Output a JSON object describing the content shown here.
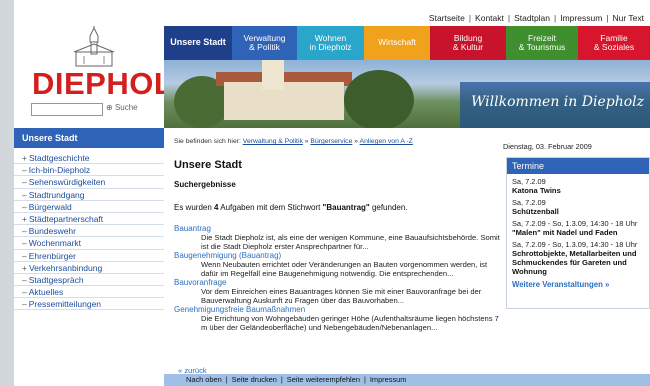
{
  "toplinks": [
    "Startseite",
    "Kontakt",
    "Stadtplan",
    "Impressum",
    "Nur Text"
  ],
  "logo": {
    "text": "DIEPHOLZ",
    "color": "#d41f1f"
  },
  "search": {
    "placeholder": "",
    "button_label": "Suche"
  },
  "nav": [
    {
      "label": "Unsere Stadt",
      "color": "#1f3f8a"
    },
    {
      "label": "Verwaltung\n& Politik",
      "color": "#2f63b7"
    },
    {
      "label": "Wohnen\nin Diepholz",
      "color": "#29a6c9"
    },
    {
      "label": "Wirtschaft",
      "color": "#f0a21c"
    },
    {
      "label": "Bildung\n& Kultur",
      "color": "#c8132c"
    },
    {
      "label": "Freizeit\n& Tourismus",
      "color": "#3f8f2f"
    },
    {
      "label": "Familie\n& Soziales",
      "color": "#d7152d"
    }
  ],
  "banner": {
    "welcome": "Willkommen in Diepholz"
  },
  "sidebar": {
    "title": "Unsere Stadt",
    "items": [
      {
        "mark": "+",
        "label": "Stadtgeschichte"
      },
      {
        "mark": "–",
        "label": "Ich-bin-Diepholz"
      },
      {
        "mark": "–",
        "label": "Sehenswürdigkeiten"
      },
      {
        "mark": "–",
        "label": "Stadtrundgang"
      },
      {
        "mark": "–",
        "label": "Bürgerwald"
      },
      {
        "mark": "+",
        "label": "Städtepartnerschaft"
      },
      {
        "mark": "–",
        "label": "Bundeswehr"
      },
      {
        "mark": "–",
        "label": "Wochenmarkt"
      },
      {
        "mark": "–",
        "label": "Ehrenbürger"
      },
      {
        "mark": "+",
        "label": "Verkehrsanbindung"
      },
      {
        "mark": "–",
        "label": "Stadtgespräch"
      },
      {
        "mark": "–",
        "label": "Aktuelles"
      },
      {
        "mark": "–",
        "label": "Pressemitteilungen"
      }
    ]
  },
  "breadcrumb": {
    "prefix": "Sie befinden sich hier:",
    "items": [
      "Verwaltung & Politik",
      "Bürgerservice",
      "Anliegen von A -Z"
    ],
    "separator": "»"
  },
  "date": "Dienstag, 03. Februar 2009",
  "main": {
    "title": "Unsere Stadt",
    "subtitle": "Suchergebnisse",
    "count_pre": "Es wurden",
    "count": "4",
    "count_mid": "Aufgaben mit dem Stichwort",
    "keyword": "\"Bauantrag\"",
    "count_post": "gefunden.",
    "results": [
      {
        "title": "Bauantrag",
        "text": "Die Stadt Diepholz ist, als eine der wenigen Kommune, eine Bauaufsichtsbehörde. Somit ist die Stadt Diepholz erster Ansprechpartner für..."
      },
      {
        "title": "Baugenehmigung (Bauantrag)",
        "text": "Wenn Neubauten errichtet oder Veränderungen an Bauten vorgenommen werden, ist dafür im Regelfall eine Baugenehmigung notwendig. Die entsprechenden..."
      },
      {
        "title": "Bauvoranfrage",
        "text": "Vor dem Einreichen eines Bauantrages können Sie mit einer Bauvoranfrage bei der Bauverwaltung Auskunft zu Fragen über das Bauvorhaben..."
      },
      {
        "title": "Genehmigungsfreie Baumaßnahmen",
        "text": "Die Errichtung von Wohngebäuden geringer Höhe (Aufenthaltsräume liegen höchstens 7 m über der Geländeoberfläche) und Nebengebäuden/Nebenanlagen..."
      }
    ],
    "back_label": "« zurück"
  },
  "termine": {
    "title": "Termine",
    "events": [
      {
        "date": "Sa, 7.2.09",
        "name": "Katona Twins"
      },
      {
        "date": "Sa, 7.2.09",
        "name": "Schützenball"
      },
      {
        "date": "Sa, 7.2.09 - So, 1.3.09, 14:30 - 18 Uhr",
        "name": "\"Malen\" mit Nadel und Faden"
      },
      {
        "date": "Sa, 7.2.09 - So, 1.3.09, 14:30 - 18 Uhr",
        "name": "Schrottobjekte, Metallarbeiten und Schmuckendes für Gareten und Wohnung"
      }
    ],
    "more": "Weitere Veranstaltungen »"
  },
  "bottom_links": [
    "Nach oben",
    "Seite drucken",
    "Seite weiterempfehlen",
    "Impressum"
  ]
}
